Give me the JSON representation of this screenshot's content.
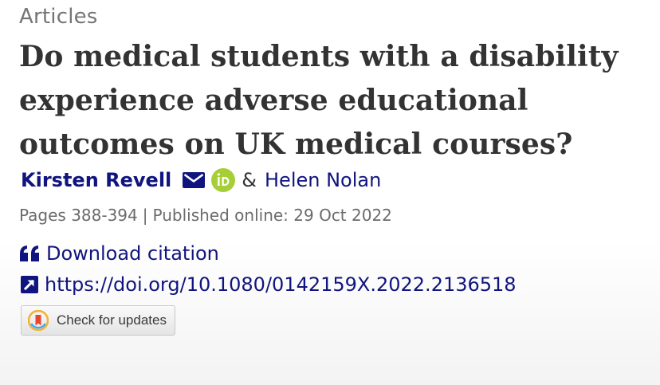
{
  "article": {
    "type_label": "Articles",
    "title": "Do medical students with a disability experience adverse educational outcomes on UK medical courses?",
    "authors": [
      {
        "name": "Kirsten Revell"
      },
      {
        "name": "Helen Nolan"
      }
    ],
    "author_separator": "&",
    "pages": "Pages 388-394",
    "meta_separator": "|",
    "published": "Published online: 29 Oct 2022"
  },
  "actions": {
    "download_citation_label": "Download citation",
    "doi_url": "https://doi.org/10.1080/0142159X.2022.2136518",
    "check_updates_label": "Check for updates"
  },
  "icons": {
    "mail": "envelope-icon",
    "orcid": "orcid-icon",
    "citation": "quote-icon",
    "doi": "external-link-icon",
    "updates": "crossmark-icon"
  },
  "colors": {
    "link": "#10147e",
    "title": "#333333",
    "muted": "#757575",
    "orcid": "#a6ce39"
  }
}
